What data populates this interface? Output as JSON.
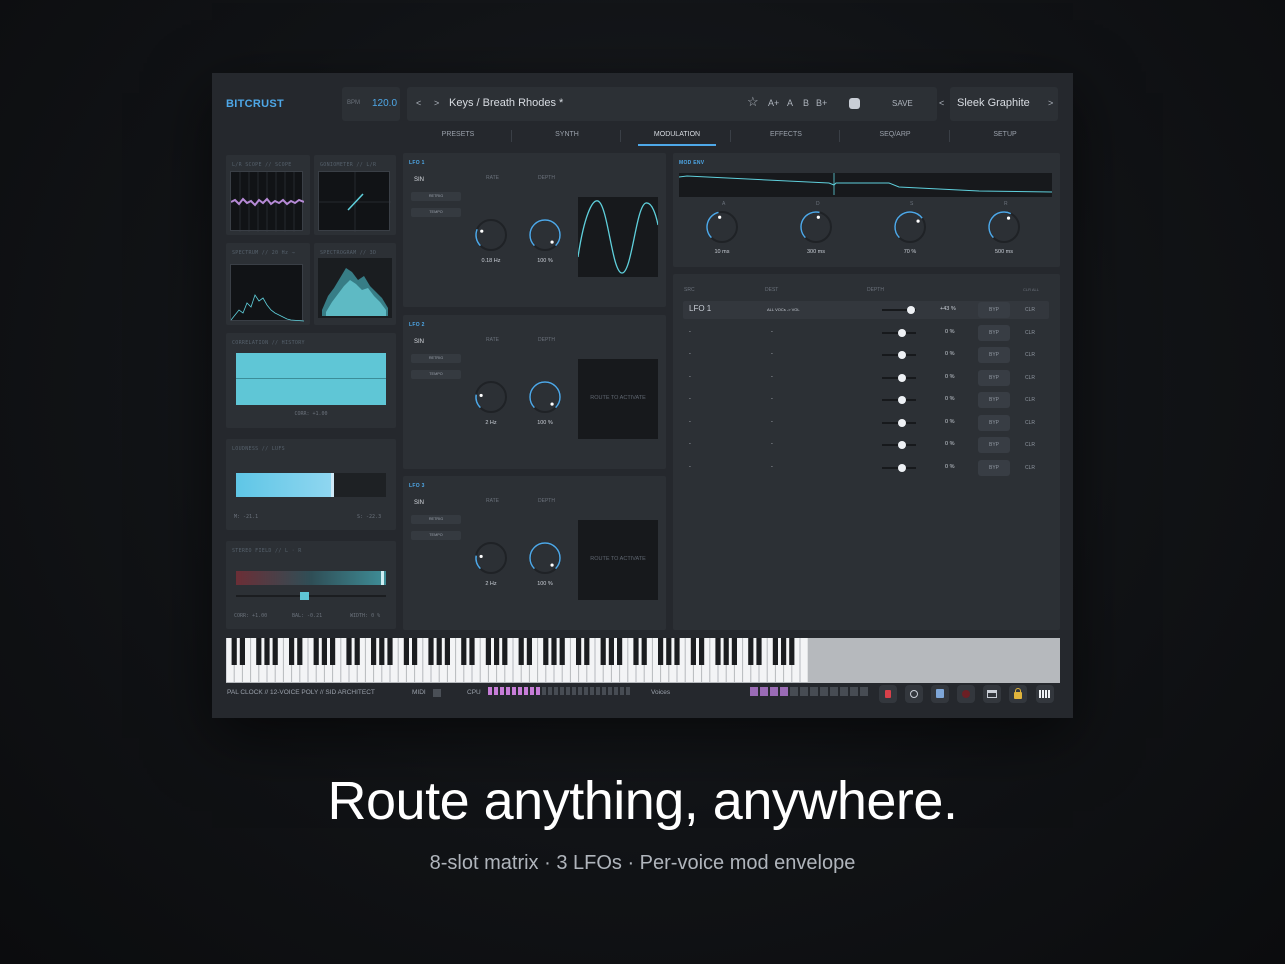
{
  "app": {
    "brand": "BITCRUST",
    "bpm_label": "BPM",
    "bpm_value": "120.0",
    "prev": "<",
    "next": ">",
    "preset_name": "Keys / Breath Rhodes *",
    "a_plus": "A+",
    "a": "A",
    "b": "B",
    "b_plus": "B+",
    "save": "SAVE",
    "theme_prev": "<",
    "theme_name": "Sleek Graphite",
    "theme_next": ">"
  },
  "tabs": [
    "PRESETS",
    "SYNTH",
    "MODULATION",
    "EFFECTS",
    "SEQ/ARP",
    "SETUP"
  ],
  "active_tab": "MODULATION",
  "meters": {
    "scope1_title": "L/R SCOPE // SCOPE",
    "scope2_title": "GONIOMETER // L/R",
    "spectrum_title": "SPECTRUM // 20 Hz →",
    "spectrogram_title": "SPECTROGRAM // 3D",
    "correlation_title": "CORRELATION // HISTORY",
    "correlation_value": "CORR: +1.00",
    "loudness_title": "LOUDNESS // LUFS",
    "loudness_m": "M: -21.1",
    "loudness_s": "S: -22.3",
    "stereo_title": "STEREO FIELD // L · R",
    "stereo_corr": "CORR: +1.00",
    "stereo_bal": "BAL: -0.21",
    "stereo_width": "WIDTH: 0 %"
  },
  "lfos": [
    {
      "title": "LFO 1",
      "shape": "SIN",
      "retrig": "RETRIG",
      "tempo": "TEMPO",
      "rate_label": "RATE",
      "depth_label": "DEPTH",
      "rate": "0.18 Hz",
      "depth": "100 %",
      "display": "wave"
    },
    {
      "title": "LFO 2",
      "shape": "SIN",
      "retrig": "RETRIG",
      "tempo": "TEMPO",
      "rate_label": "RATE",
      "depth_label": "DEPTH",
      "rate": "2 Hz",
      "depth": "100 %",
      "display": "ROUTE TO ACTIVATE"
    },
    {
      "title": "LFO 3",
      "shape": "SIN",
      "retrig": "RETRIG",
      "tempo": "TEMPO",
      "rate_label": "RATE",
      "depth_label": "DEPTH",
      "rate": "2 Hz",
      "depth": "100 %",
      "display": "ROUTE TO ACTIVATE"
    }
  ],
  "mod_env": {
    "title": "MOD ENV",
    "knobs": [
      {
        "label": "A",
        "value": "10 ms"
      },
      {
        "label": "D",
        "value": "300 ms"
      },
      {
        "label": "S",
        "value": "70 %"
      },
      {
        "label": "R",
        "value": "500 ms"
      }
    ]
  },
  "matrix": {
    "headers": {
      "src": "SRC",
      "dest": "DEST",
      "depth": "DEPTH",
      "clear_all": "CLR ALL"
    },
    "rows": [
      {
        "src": "LFO 1",
        "dest": "ALL VOCs -> VOL",
        "depth": "+43 %",
        "byp": "BYP",
        "clr": "CLR",
        "level": 0.86
      },
      {
        "src": "-",
        "dest": "-",
        "depth": "0 %",
        "byp": "BYP",
        "clr": "CLR",
        "level": 0.6
      },
      {
        "src": "-",
        "dest": "-",
        "depth": "0 %",
        "byp": "BYP",
        "clr": "CLR",
        "level": 0.6
      },
      {
        "src": "-",
        "dest": "-",
        "depth": "0 %",
        "byp": "BYP",
        "clr": "CLR",
        "level": 0.6
      },
      {
        "src": "-",
        "dest": "-",
        "depth": "0 %",
        "byp": "BYP",
        "clr": "CLR",
        "level": 0.6
      },
      {
        "src": "-",
        "dest": "-",
        "depth": "0 %",
        "byp": "BYP",
        "clr": "CLR",
        "level": 0.6
      },
      {
        "src": "-",
        "dest": "-",
        "depth": "0 %",
        "byp": "BYP",
        "clr": "CLR",
        "level": 0.6
      },
      {
        "src": "-",
        "dest": "-",
        "depth": "0 %",
        "byp": "BYP",
        "clr": "CLR",
        "level": 0.6
      }
    ]
  },
  "status": {
    "engine": "PAL CLOCK // 12-VOICE POLY // SID ARCHITECT",
    "midi": "MIDI",
    "cpu": "CPU",
    "cpu_level": 0.37,
    "voices": "Voices",
    "voices_active": 4,
    "voices_total": 12
  },
  "colors": {
    "accent": "#4ea8e8",
    "cpu": "#c77dd8",
    "teal": "#5fd0dc"
  },
  "marketing": {
    "headline": "Route anything, anywhere.",
    "sub": "8-slot matrix  ·  3 LFOs  ·  Per-voice mod envelope"
  }
}
